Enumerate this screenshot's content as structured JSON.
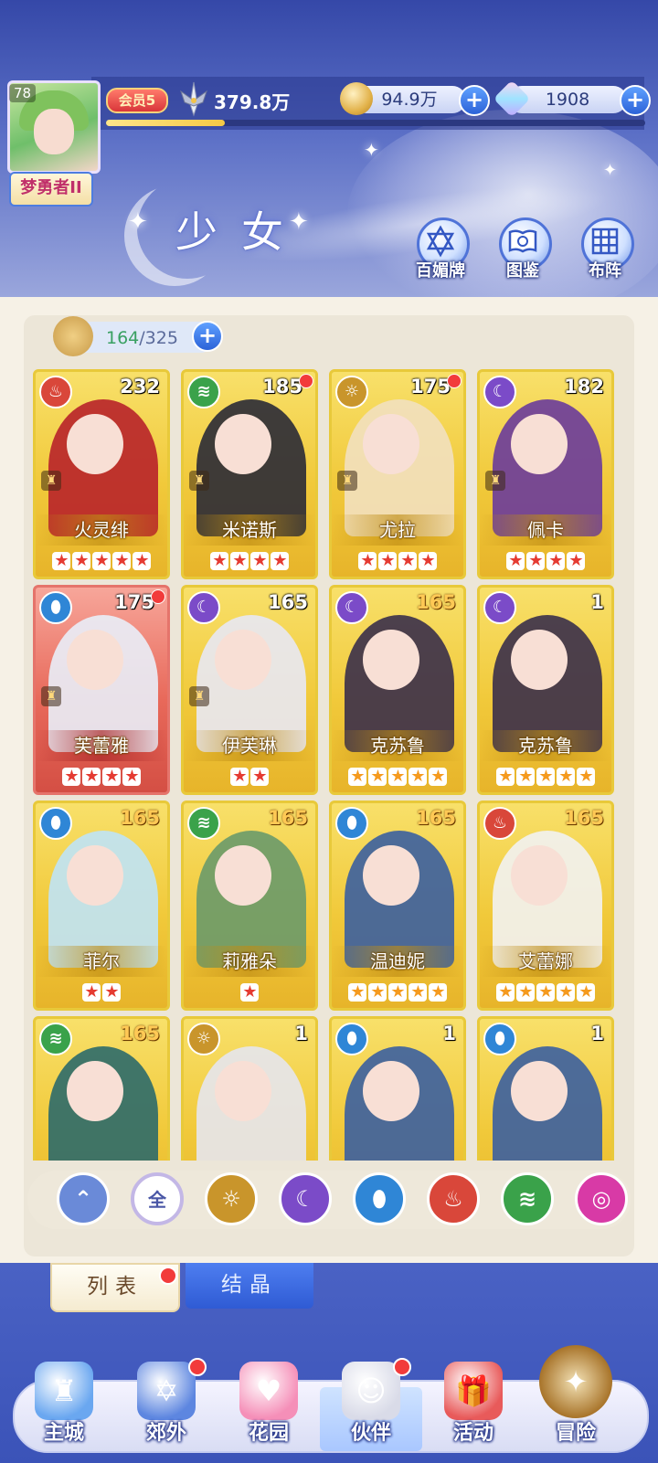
{
  "header": {
    "player_level": "78",
    "player_title": "梦勇者II",
    "vip_label": "会员5",
    "power": "379.8万",
    "gold": "94.9万",
    "gems": "1908",
    "exp_progress": 0.22,
    "page_title": "少女",
    "tool_buttons": [
      {
        "label": "百媚牌",
        "icon": "card-deck-icon"
      },
      {
        "label": "图鉴",
        "icon": "book-icon"
      },
      {
        "label": "布阵",
        "icon": "formation-grid-icon"
      }
    ]
  },
  "roster": {
    "owned": "164",
    "capacity": "/325"
  },
  "cards": [
    {
      "name": "火灵绯",
      "level": "232",
      "element": "fire",
      "stars": 5,
      "star_color": "red",
      "red_dot": false,
      "highlight": false,
      "rank_icon": true
    },
    {
      "name": "米诺斯",
      "level": "185",
      "element": "wind",
      "stars": 4,
      "star_color": "red",
      "red_dot": true,
      "highlight": false,
      "rank_icon": true
    },
    {
      "name": "尤拉",
      "level": "175",
      "element": "light",
      "stars": 4,
      "star_color": "red",
      "red_dot": true,
      "highlight": false,
      "rank_icon": true
    },
    {
      "name": "佩卡",
      "level": "182",
      "element": "dark",
      "stars": 4,
      "star_color": "red",
      "red_dot": false,
      "highlight": false,
      "rank_icon": true
    },
    {
      "name": "芙蕾雅",
      "level": "175",
      "element": "water",
      "stars": 4,
      "star_color": "red",
      "red_dot": true,
      "highlight": true,
      "rank_icon": true
    },
    {
      "name": "伊芙琳",
      "level": "165",
      "element": "dark",
      "stars": 2,
      "star_color": "red",
      "red_dot": false,
      "highlight": false,
      "rank_icon": true
    },
    {
      "name": "克苏鲁",
      "level": "165",
      "element": "dark",
      "stars": 5,
      "star_color": "orange",
      "red_dot": false,
      "highlight": false,
      "rank_icon": false,
      "level_orange": true
    },
    {
      "name": "克苏鲁",
      "level": "1",
      "element": "dark",
      "stars": 5,
      "star_color": "orange",
      "red_dot": false,
      "highlight": false,
      "rank_icon": false
    },
    {
      "name": "菲尔",
      "level": "165",
      "element": "water",
      "stars": 2,
      "star_color": "red",
      "red_dot": false,
      "highlight": false,
      "rank_icon": false,
      "level_orange": true
    },
    {
      "name": "莉雅朵",
      "level": "165",
      "element": "wind",
      "stars": 1,
      "star_color": "red",
      "red_dot": false,
      "highlight": false,
      "rank_icon": false,
      "level_orange": true
    },
    {
      "name": "温迪妮",
      "level": "165",
      "element": "water",
      "stars": 5,
      "star_color": "orange",
      "red_dot": false,
      "highlight": false,
      "rank_icon": false,
      "level_orange": true
    },
    {
      "name": "艾蕾娜",
      "level": "165",
      "element": "fire",
      "stars": 5,
      "star_color": "orange",
      "red_dot": false,
      "highlight": false,
      "rank_icon": false,
      "level_orange": true
    },
    {
      "name": "",
      "level": "165",
      "element": "wind",
      "stars": 0,
      "star_color": "red",
      "red_dot": false,
      "highlight": false,
      "rank_icon": false,
      "level_orange": true
    },
    {
      "name": "",
      "level": "1",
      "element": "light",
      "stars": 0,
      "star_color": "red",
      "red_dot": false,
      "highlight": false,
      "rank_icon": false
    },
    {
      "name": "",
      "level": "1",
      "element": "water",
      "stars": 0,
      "star_color": "red",
      "red_dot": false,
      "highlight": false,
      "rank_icon": false
    },
    {
      "name": "",
      "level": "1",
      "element": "water",
      "stars": 0,
      "star_color": "red",
      "red_dot": false,
      "highlight": false,
      "rank_icon": false
    }
  ],
  "filters": [
    {
      "id": "sort",
      "label": "",
      "icon": "sort-up-icon"
    },
    {
      "id": "all",
      "label": "全",
      "icon": "all-icon"
    },
    {
      "id": "light",
      "label": "",
      "icon": "sun-icon"
    },
    {
      "id": "dark",
      "label": "",
      "icon": "moon-icon"
    },
    {
      "id": "water",
      "label": "",
      "icon": "water-drop-icon"
    },
    {
      "id": "fire",
      "label": "",
      "icon": "flame-icon"
    },
    {
      "id": "wind",
      "label": "",
      "icon": "wind-icon"
    },
    {
      "id": "arcane",
      "label": "",
      "icon": "orbit-icon"
    }
  ],
  "sub_tabs": {
    "list": "列表",
    "crystal": "结晶"
  },
  "nav": [
    {
      "label": "主城",
      "icon": "castle-icon",
      "red_dot": false
    },
    {
      "label": "郊外",
      "icon": "magic-circle-icon",
      "red_dot": true
    },
    {
      "label": "花园",
      "icon": "heart-icon",
      "red_dot": false
    },
    {
      "label": "伙伴",
      "icon": "partner-avatar-icon",
      "red_dot": true
    },
    {
      "label": "活动",
      "icon": "gift-icon",
      "red_dot": false
    },
    {
      "label": "冒险",
      "icon": "compass-icon",
      "red_dot": false
    }
  ],
  "colors": {
    "fire": "#d9473a",
    "wind": "#3aa24a",
    "light": "#c9952b",
    "dark": "#7b4bc8",
    "water": "#2f86d6",
    "arcane": "#d83aa6",
    "sort": "#6a8ad8"
  }
}
